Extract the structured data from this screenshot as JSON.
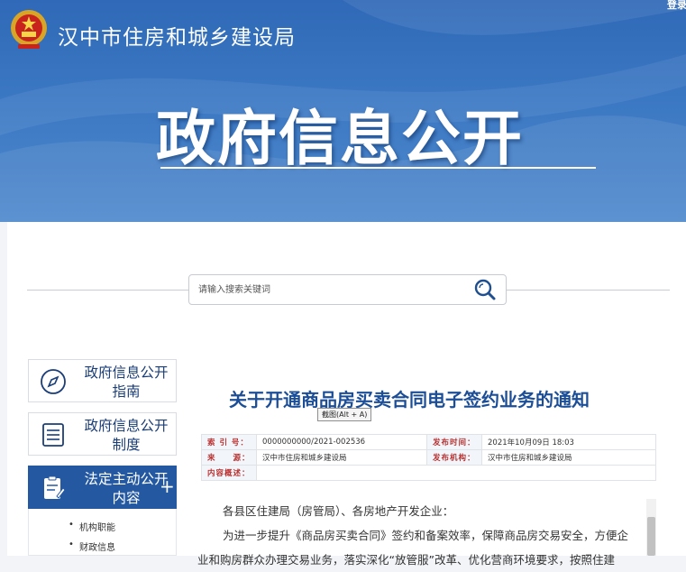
{
  "header": {
    "site_name": "汉中市住房和城乡建设局",
    "login": "登录",
    "banner_title": "政府信息公开"
  },
  "search": {
    "placeholder": "请输入搜索关键词"
  },
  "sidebar": {
    "items": [
      {
        "label": "政府信息公开指南",
        "icon": "compass-icon"
      },
      {
        "label": "政府信息公开制度",
        "icon": "document-list-icon"
      },
      {
        "label": "法定主动公开内容",
        "icon": "clipboard-edit-icon",
        "active": true,
        "expand": "+"
      }
    ],
    "sub_items": [
      "机构职能",
      "财政信息"
    ]
  },
  "article": {
    "title": "关于开通商品房买卖合同电子签约业务的通知",
    "tooltip": "截图(Alt + A)",
    "meta": {
      "index_label": "索 引 号：",
      "index_value": "0000000000/2021-002536",
      "date_label": "发布时间：",
      "date_value": "2021年10月09日 18:03",
      "source_label": "来　　源：",
      "source_value": "汉中市住房和城乡建设局",
      "org_label": "发布机构：",
      "org_value": "汉中市住房和城乡建设局",
      "summary_label": "内容概述："
    },
    "paragraphs": [
      "各县区住建局（房管局）、各房地产开发企业：",
      "为进一步提升《商品房买卖合同》签约和备案效率，保障商品房交易安全，方便企",
      "业和购房群众办理交易业务，落实深化“放管服”改革、优化营商环境要求，按照住建"
    ]
  },
  "colors": {
    "banner": "#3b78c3",
    "accent": "#2459a2",
    "title": "#1c4e97",
    "meta_label": "#b83232"
  }
}
